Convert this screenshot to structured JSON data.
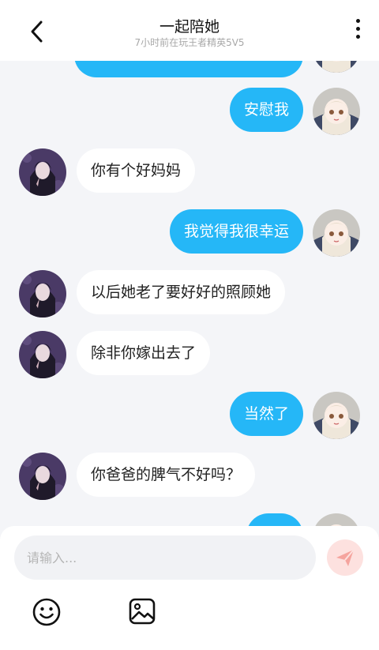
{
  "header": {
    "title": "一起陪她",
    "subtitle": "7小时前在玩王者精英5V5"
  },
  "messages": [
    {
      "from": "me",
      "text": ""
    },
    {
      "from": "me",
      "text": "安慰我"
    },
    {
      "from": "them",
      "text": "你有个好妈妈"
    },
    {
      "from": "me",
      "text": "我觉得我很幸运"
    },
    {
      "from": "them",
      "text": "以后她老了要好好的照顾她"
    },
    {
      "from": "them",
      "text": "除非你嫁出去了"
    },
    {
      "from": "me",
      "text": "当然了"
    },
    {
      "from": "them",
      "text": "你爸爸的脾气不好吗？"
    },
    {
      "from": "me",
      "text": ""
    }
  ],
  "composer": {
    "placeholder": "请输入..."
  },
  "icons": {
    "back": "back-arrow-icon",
    "more": "more-vertical-icon",
    "send": "send-plane-icon",
    "emoji": "emoji-smile-icon",
    "image": "image-icon"
  },
  "colors": {
    "my_bubble": "#25b7f7",
    "their_bubble": "#ffffff",
    "background": "#f4f5f8",
    "send_button": "#fde1df",
    "send_icon": "#f5a49e"
  }
}
